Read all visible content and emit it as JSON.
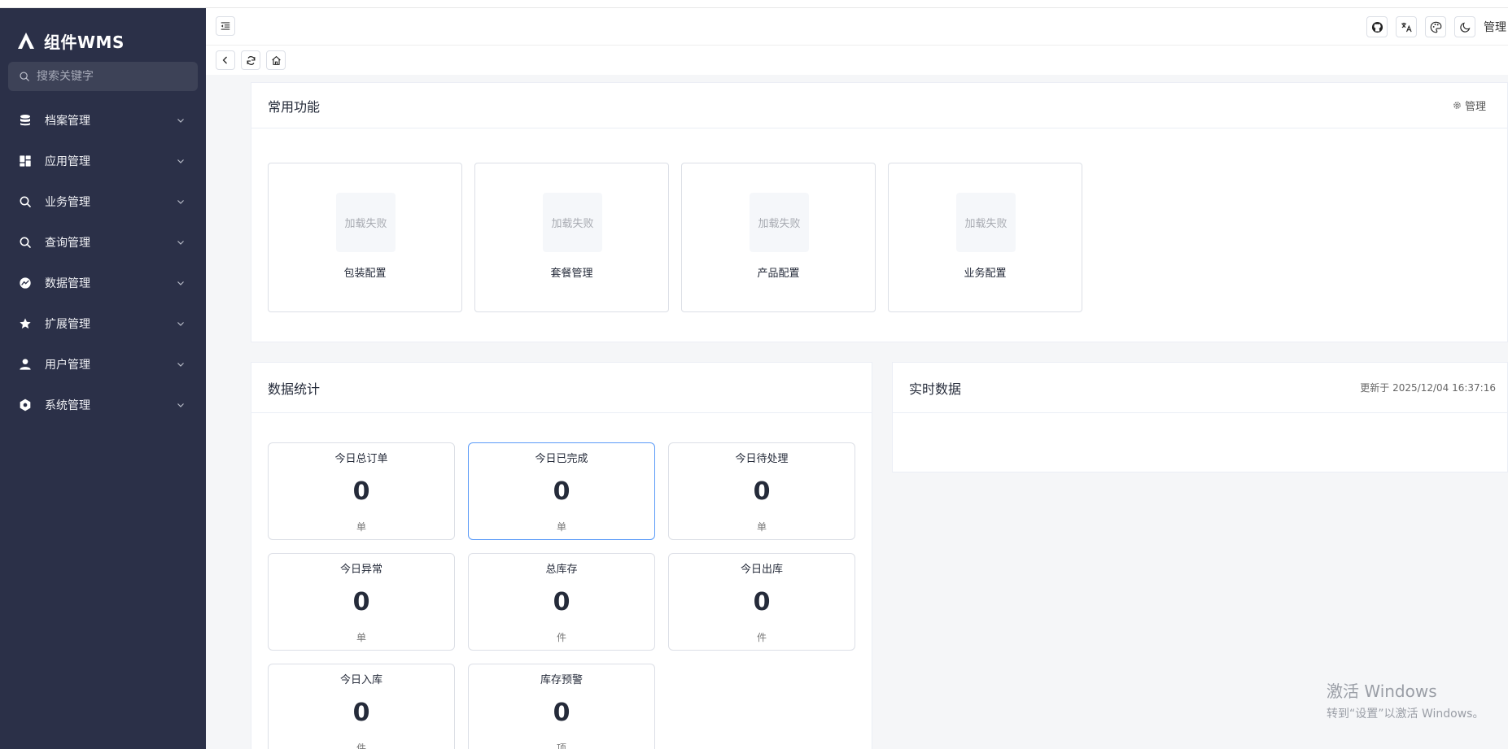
{
  "app": {
    "name": "组件WMS"
  },
  "sidebar": {
    "search_placeholder": "搜索关键字",
    "items": [
      {
        "label": "档案管理",
        "icon": "database-icon"
      },
      {
        "label": "应用管理",
        "icon": "dashboard-icon"
      },
      {
        "label": "业务管理",
        "icon": "search-icon"
      },
      {
        "label": "查询管理",
        "icon": "search-icon"
      },
      {
        "label": "数据管理",
        "icon": "chart-circle-icon"
      },
      {
        "label": "扩展管理",
        "icon": "star-icon"
      },
      {
        "label": "用户管理",
        "icon": "user-icon"
      },
      {
        "label": "系统管理",
        "icon": "settings-icon"
      }
    ]
  },
  "header": {
    "user": "管理"
  },
  "common": {
    "title": "常用功能",
    "manage_label": "管理",
    "items": [
      {
        "label": "包装配置",
        "image_text": "加载失败"
      },
      {
        "label": "套餐管理",
        "image_text": "加载失败"
      },
      {
        "label": "产品配置",
        "image_text": "加载失败"
      },
      {
        "label": "业务配置",
        "image_text": "加载失败"
      }
    ]
  },
  "stats": {
    "title": "数据统计",
    "items": [
      {
        "label": "今日总订单",
        "value": "0",
        "unit": "单"
      },
      {
        "label": "今日已完成",
        "value": "0",
        "unit": "单"
      },
      {
        "label": "今日待处理",
        "value": "0",
        "unit": "单"
      },
      {
        "label": "今日异常",
        "value": "0",
        "unit": "单"
      },
      {
        "label": "总库存",
        "value": "0",
        "unit": "件"
      },
      {
        "label": "今日出库",
        "value": "0",
        "unit": "件"
      },
      {
        "label": "今日入库",
        "value": "0",
        "unit": "件"
      },
      {
        "label": "库存预警",
        "value": "0",
        "unit": "项"
      }
    ]
  },
  "realtime": {
    "title": "实时数据",
    "updated": "更新于 2025/12/04 16:37:16"
  },
  "watermark": {
    "title": "激活 Windows",
    "subtitle": "转到“设置”以激活 Windows。"
  }
}
